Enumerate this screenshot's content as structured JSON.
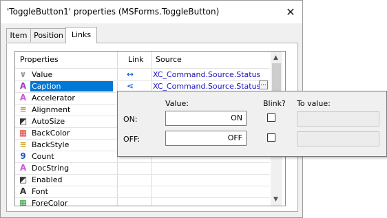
{
  "window": {
    "title": "'ToggleButton1' properties (MSForms.ToggleButton)",
    "close_glyph": "✕"
  },
  "tabs": [
    {
      "label": "Item"
    },
    {
      "label": "Position"
    },
    {
      "label": "Links",
      "active": true
    }
  ],
  "grid": {
    "headers": {
      "properties": "Properties",
      "link": "Link",
      "source": "Source"
    },
    "rows": [
      {
        "label": "Value",
        "icon": "value-icon",
        "link": "↔",
        "source": "XC_Command.Source.Status"
      },
      {
        "label": "Caption",
        "icon": "caption-icon",
        "link": "⋖",
        "source": "XC_Command.Source.Status",
        "selected": true
      },
      {
        "label": "Accelerator",
        "icon": "accelerator-icon"
      },
      {
        "label": "Alignment",
        "icon": "alignment-icon"
      },
      {
        "label": "AutoSize",
        "icon": "autosize-icon"
      },
      {
        "label": "BackColor",
        "icon": "backcolor-icon"
      },
      {
        "label": "BackStyle",
        "icon": "backstyle-icon"
      },
      {
        "label": "Count",
        "icon": "count-icon"
      },
      {
        "label": "DocString",
        "icon": "docstring-icon"
      },
      {
        "label": "Enabled",
        "icon": "enabled-icon"
      },
      {
        "label": "Font",
        "icon": "font-icon"
      },
      {
        "label": "ForeColor",
        "icon": "forecolor-icon"
      }
    ],
    "ellipsis": "..."
  },
  "popup": {
    "value_header": "Value:",
    "blink_header": "Blink?",
    "to_value_header": "To value:",
    "on_label": "ON:",
    "off_label": "OFF:",
    "on_value": "ON",
    "off_value": "OFF"
  },
  "colors": {
    "selection": "#0078d7",
    "source_text": "#1a14c4",
    "icon_purple": "#9b3fb6"
  }
}
